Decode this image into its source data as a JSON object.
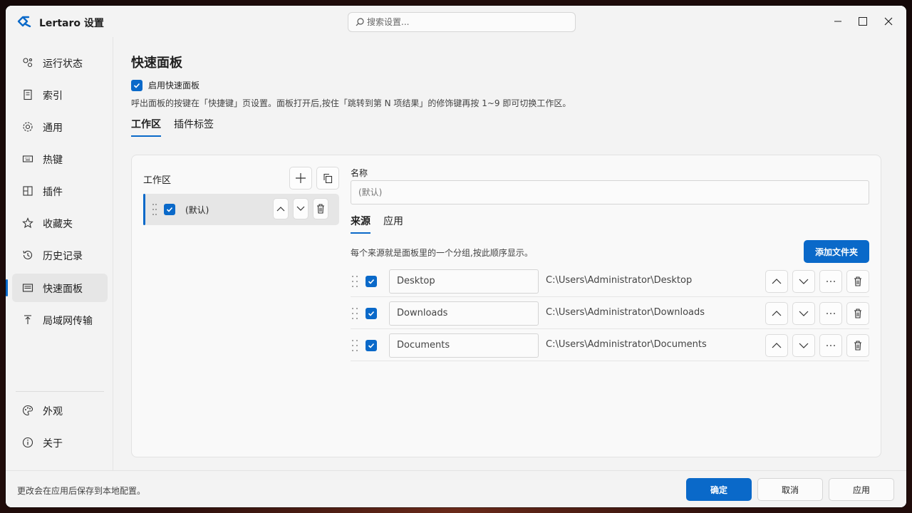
{
  "app": {
    "title": "Lertaro 设置"
  },
  "search": {
    "placeholder": "搜索设置..."
  },
  "sidebar": {
    "items": [
      {
        "label": "运行状态",
        "icon": "status-icon"
      },
      {
        "label": "索引",
        "icon": "index-icon"
      },
      {
        "label": "通用",
        "icon": "gear-icon"
      },
      {
        "label": "热键",
        "icon": "keyboard-icon"
      },
      {
        "label": "插件",
        "icon": "plugin-icon"
      },
      {
        "label": "收藏夹",
        "icon": "star-icon"
      },
      {
        "label": "历史记录",
        "icon": "history-icon"
      },
      {
        "label": "快速面板",
        "icon": "panel-icon",
        "active": true
      },
      {
        "label": "局域网传输",
        "icon": "upload-icon"
      }
    ],
    "bottom_items": [
      {
        "label": "外观",
        "icon": "palette-icon"
      },
      {
        "label": "关于",
        "icon": "info-icon"
      }
    ]
  },
  "main": {
    "title": "快速面板",
    "enable_label": "启用快速面板",
    "hint": "呼出面板的按键在「快捷键」页设置。面板打开后,按住「跳转到第 N 项结果」的修饰键再按 1~9 即可切换工作区。",
    "tabs": [
      {
        "label": "工作区",
        "active": true
      },
      {
        "label": "插件标签"
      }
    ],
    "workspace_label": "工作区",
    "workspaces": [
      {
        "name": "(默认)",
        "checked": true
      }
    ],
    "name_label": "名称",
    "name_placeholder": "(默认)",
    "inner_tabs": [
      {
        "label": "来源",
        "active": true
      },
      {
        "label": "应用"
      }
    ],
    "sources_hint": "每个来源就是面板里的一个分组,按此顺序显示。",
    "add_folder_label": "添加文件夹",
    "sources": [
      {
        "name": "Desktop",
        "path": "C:\\Users\\Administrator\\Desktop",
        "checked": true
      },
      {
        "name": "Downloads",
        "path": "C:\\Users\\Administrator\\Downloads",
        "checked": true
      },
      {
        "name": "Documents",
        "path": "C:\\Users\\Administrator\\Documents",
        "checked": true
      }
    ],
    "more_label": "···"
  },
  "footer": {
    "text": "更改会在应用后保存到本地配置。",
    "ok_label": "确定",
    "cancel_label": "取消",
    "apply_label": "应用"
  },
  "colors": {
    "accent": "#0a69c9",
    "window_bg": "#f3f3f3"
  }
}
